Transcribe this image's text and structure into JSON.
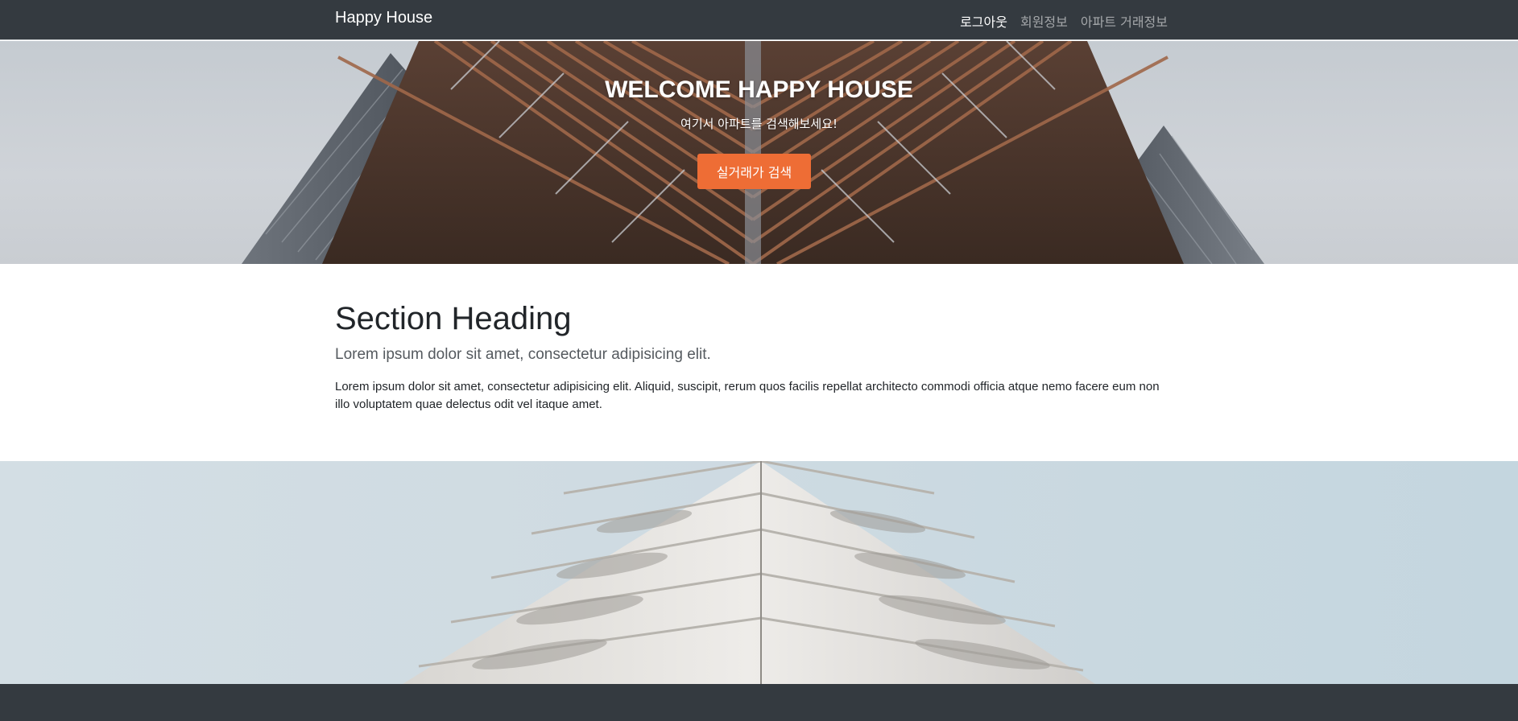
{
  "navbar": {
    "brand": "Happy House",
    "links": [
      {
        "label": "로그아웃",
        "active": true
      },
      {
        "label": "회원정보",
        "active": false
      },
      {
        "label": "아파트 거래정보",
        "active": false
      }
    ]
  },
  "hero": {
    "title": "WELCOME HAPPY HOUSE",
    "subtitle": "여기서 아파트를 검색해보세요!",
    "button_label": "실거래가 검색"
  },
  "section": {
    "heading": "Section Heading",
    "lead": "Lorem ipsum dolor sit amet, consectetur adipisicing elit.",
    "body": "Lorem ipsum dolor sit amet, consectetur adipisicing elit. Aliquid, suscipit, rerum quos facilis repellat architecto commodi officia atque nemo facere eum non illo voluptatem quae delectus odit vel itaque amet."
  },
  "colors": {
    "navbar_bg": "#343a40",
    "accent_button": "#ee6d35",
    "footer_bg": "#343a40"
  }
}
